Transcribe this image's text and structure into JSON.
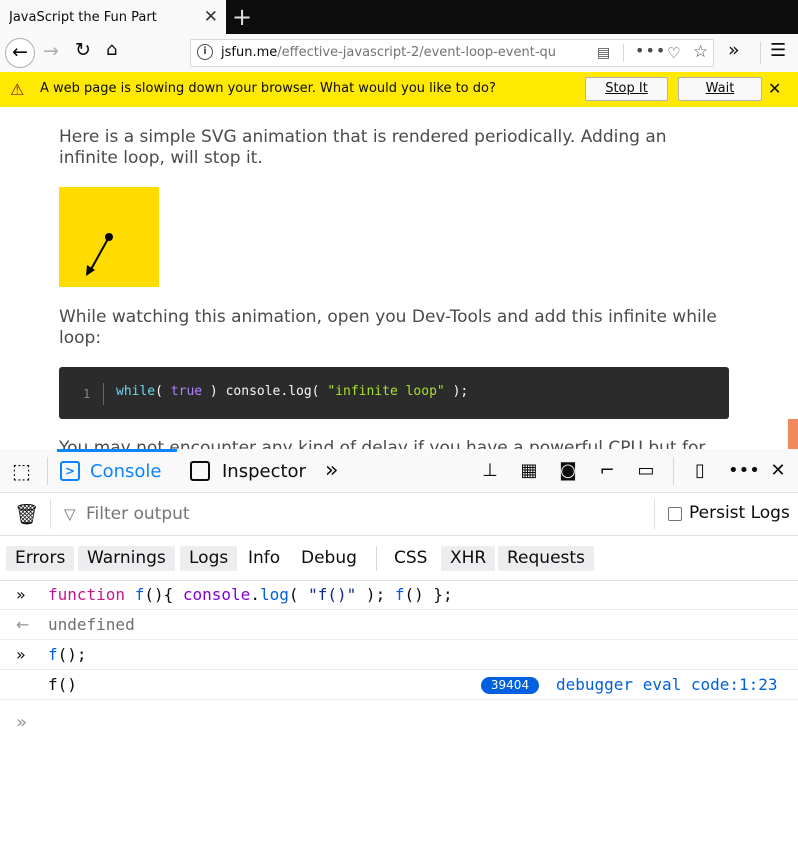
{
  "browser": {
    "tab_title": "JavaScript the Fun Part",
    "tab_close": "✕",
    "new_tab": "+",
    "url_host": "jsfun.me",
    "url_path": "/effective-javascript-2/event-loop-event-qu"
  },
  "notification": {
    "message": "A web page is slowing down your browser. What would you like to do?",
    "stop_label": "Stop It",
    "wait_label": "Wait",
    "close": "✕"
  },
  "page": {
    "para1": "Here is a simple SVG animation that is rendered periodically. Adding an infinite loop, will stop it.",
    "para2": "While watching this animation, open you Dev-Tools and add this infinite while loop:",
    "code_line_number": "1",
    "code_tokens": [
      "while",
      "( ",
      "true",
      " ) console.log( ",
      "\"infinite loop\"",
      " );"
    ],
    "para3": "You may not encounter any kind of delay if you have a powerful CPU but for me it"
  },
  "devtools": {
    "tab_console": "Console",
    "tab_inspector": "Inspector",
    "filter_placeholder": "Filter output",
    "persist_logs": "Persist Logs",
    "levels": [
      "Errors",
      "Warnings",
      "Logs",
      "Info",
      "Debug"
    ],
    "categories": [
      "CSS",
      "XHR",
      "Requests"
    ],
    "output": {
      "row1_tokens": [
        "function",
        " ",
        "f",
        "(){ ",
        "console",
        ".",
        "log",
        "( ",
        "\"f()\"",
        " ); ",
        "f",
        "() };"
      ],
      "row2": "undefined",
      "row3_tokens": [
        "f",
        "();"
      ],
      "row4_text": "f()",
      "row4_count": "39404",
      "row4_source": "debugger eval code",
      "row4_pos": ":1:23"
    }
  },
  "colors": {
    "accent": "#0a84ff",
    "notification_bg": "#ffe900",
    "svg_bg": "#ffdc00",
    "code_bg": "#2b2b2b"
  }
}
